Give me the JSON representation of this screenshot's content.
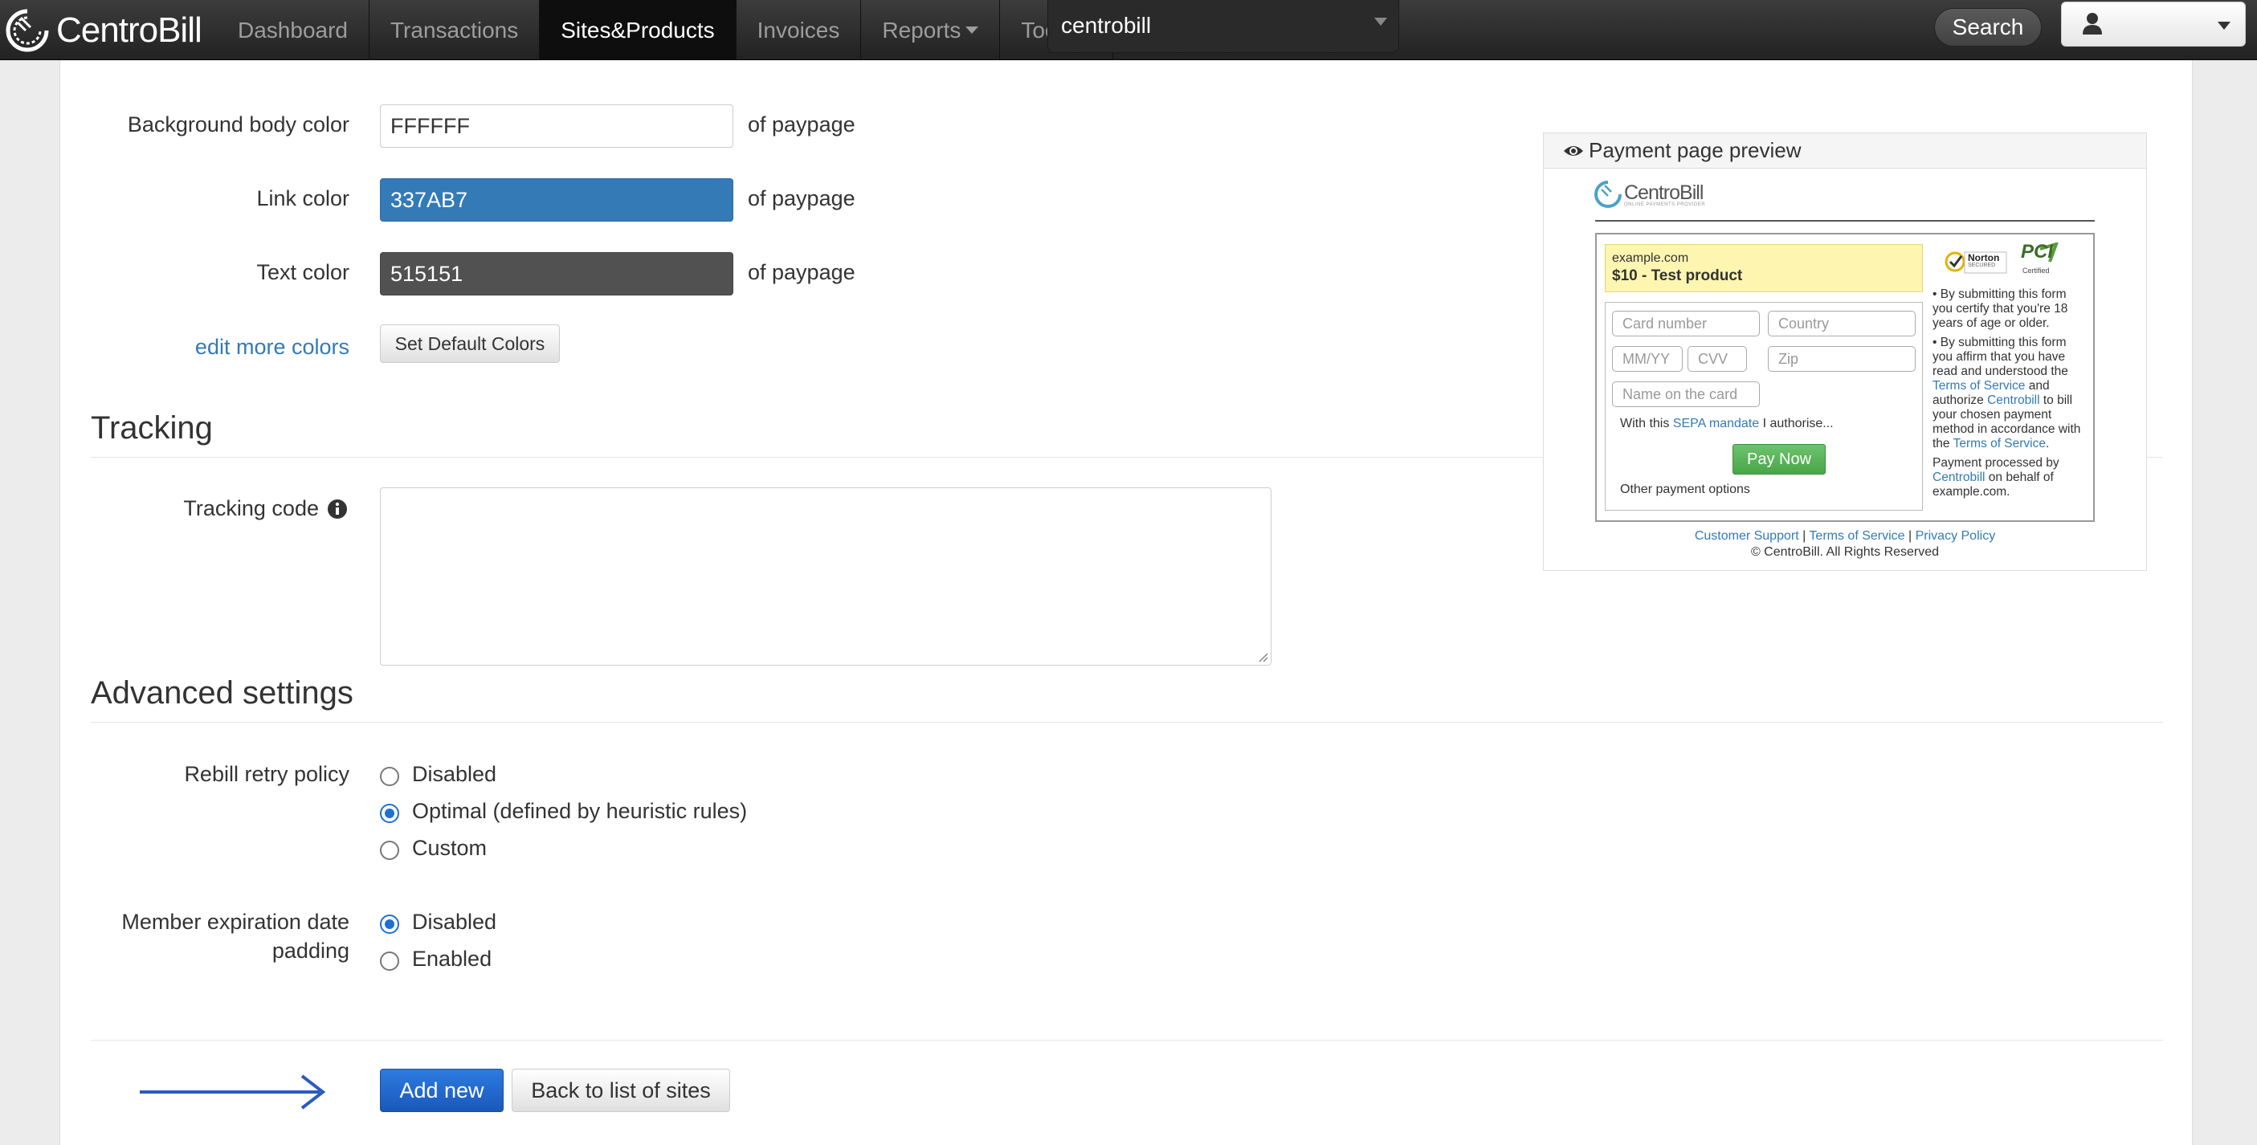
{
  "navbar": {
    "brand": "CentroBill",
    "items": [
      {
        "label": "Dashboard",
        "active": false,
        "dropdown": false
      },
      {
        "label": "Transactions",
        "active": false,
        "dropdown": false
      },
      {
        "label": "Sites&Products",
        "active": true,
        "dropdown": false
      },
      {
        "label": "Invoices",
        "active": false,
        "dropdown": false
      },
      {
        "label": "Reports",
        "active": false,
        "dropdown": true
      },
      {
        "label": "Tools",
        "active": false,
        "dropdown": true
      }
    ],
    "site_select_value": "centrobill",
    "search_label": "Search",
    "user_icon": "user-icon"
  },
  "colors_form": {
    "bg_label": "Background body color",
    "bg_value": "FFFFFF",
    "link_label": "Link color",
    "link_value": "337AB7",
    "text_label": "Text color",
    "text_value": "515151",
    "suffix": "of paypage",
    "edit_more": "edit more colors",
    "set_default": "Set Default Colors",
    "swatches": {
      "background": "#FFFFFF",
      "link": "#337AB7",
      "text": "#515151"
    }
  },
  "tracking": {
    "title": "Tracking",
    "code_label": "Tracking code",
    "code_value": "",
    "info_icon": "info-icon"
  },
  "advanced": {
    "title": "Advanced settings",
    "rebill_label": "Rebill retry policy",
    "rebill_options": [
      {
        "label": "Disabled",
        "checked": false
      },
      {
        "label": "Optimal (defined by heuristic rules)",
        "checked": true
      },
      {
        "label": "Custom",
        "checked": false
      }
    ],
    "expiration_label_1": "Member expiration date",
    "expiration_label_2": "padding",
    "expiration_options": [
      {
        "label": "Disabled",
        "checked": true
      },
      {
        "label": "Enabled",
        "checked": false
      }
    ]
  },
  "actions": {
    "add_new": "Add new",
    "back": "Back to list of sites",
    "primary_color": "#1f62c8"
  },
  "preview": {
    "title": "Payment page preview",
    "logo_text": "CentroBill",
    "logo_sub": "ONLINE PAYMENTS PROVIDER",
    "product_site": "example.com",
    "product_name": "$10 - Test product",
    "placeholders": {
      "card_number": "Card number",
      "country": "Country",
      "expiry": "MM/YY",
      "cvv": "CVV",
      "zip": "Zip",
      "name": "Name on the card"
    },
    "sepa_pre": "With this ",
    "sepa_link": "SEPA mandate",
    "sepa_post": " I authorise...",
    "pay_now": "Pay Now",
    "other_options": "Other payment options",
    "badge_norton": "Norton",
    "badge_norton_sub": "SECURED",
    "badge_pci": "PCI",
    "badge_pci_sub": "Certified",
    "notice1": "• By submitting this form you certify that you're 18 years of age or older.",
    "notice2_pre": "• By submitting this form you affirm that you have read and understood the ",
    "notice2_tos": "Terms of Service",
    "notice2_mid": " and authorize ",
    "notice2_cb": "Centrobill",
    "notice2_post": " to bill your chosen payment method in accordance with the ",
    "notice2_tos2": "Terms of Service",
    "notice2_end": ".",
    "processed_pre": "Payment processed by ",
    "processed_cb": "Centrobill",
    "processed_post": " on behalf of example.com.",
    "footer_support": "Customer Support",
    "footer_sep": " | ",
    "footer_tos": "Terms of Service",
    "footer_privacy": "Privacy Policy",
    "copyright": "© CentroBill. All Rights Reserved"
  }
}
